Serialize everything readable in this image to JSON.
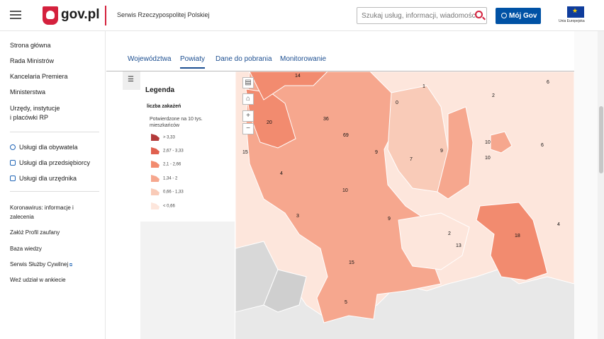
{
  "header": {
    "brand": "gov.pl",
    "service": "Serwis Rzeczypospolitej Polskiej",
    "search_placeholder": "Szukaj usług, informacji, wiadomości",
    "login_label": "Mój Gov",
    "eu_label": "Unia Europejska"
  },
  "sidebar": {
    "main": [
      "Strona główna",
      "Rada Ministrów",
      "Kancelaria Premiera",
      "Ministerstwa",
      "Urzędy, instytucje",
      "i placówki RP"
    ],
    "services": [
      "Usługi dla obywatela",
      "Usługi dla przedsiębiorcy",
      "Usługi dla urzędnika"
    ],
    "links": [
      "Koronawirus: informacje i",
      "zalecenia",
      "Załóż Profil zaufany",
      "Baza wiedzy",
      "Serwis Służby Cywilnej",
      "Weź udział w ankiecie"
    ]
  },
  "tabs": [
    "Województwa",
    "Powiaty",
    "Dane do pobrania",
    "Monitorowanie"
  ],
  "legend": {
    "title": "Legenda",
    "subtitle": "liczba zakażeń",
    "desc_1": "Potwierdzone na 10 tys.",
    "desc_2": "mieszkańców",
    "ranges": [
      "> 3,33",
      "2,67 - 3,33",
      "2,1 - 2,66",
      "1,34 - 2",
      "0,66 - 1,33",
      "< 0,66"
    ],
    "colors": [
      "#b33a3a",
      "#e0604f",
      "#f28b6f",
      "#f6a78e",
      "#f9cbb8",
      "#fde6dc"
    ]
  },
  "map": {
    "numbers": [
      "14",
      "1",
      "6",
      "2",
      "0",
      "20",
      "36",
      "69",
      "15",
      "9",
      "7",
      "9",
      "10",
      "10",
      "6",
      "4",
      "10",
      "3",
      "9",
      "2",
      "13",
      "18",
      "4",
      "15",
      "5"
    ],
    "buttons": [
      "▤",
      "⌂",
      "+",
      "−"
    ]
  }
}
